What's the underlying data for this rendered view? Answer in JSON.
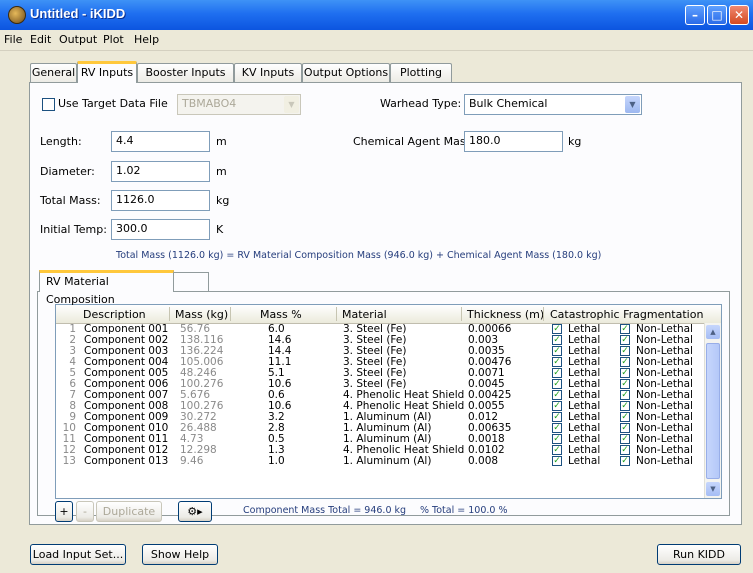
{
  "window": {
    "title": "Untitled - iKIDD",
    "controls": {
      "minimize": "–",
      "maximize": "□",
      "close": "✕"
    }
  },
  "menu": [
    "File",
    "Edit",
    "Output",
    "Plot",
    "Help"
  ],
  "tabs": [
    "General",
    "RV Inputs",
    "Booster Inputs",
    "KV Inputs",
    "Output Options",
    "Plotting"
  ],
  "active_tab": "RV Inputs",
  "form": {
    "use_target_label": "Use Target Data File",
    "target_file": "TBMABO4",
    "warhead_label": "Warhead Type:",
    "warhead_value": "Bulk Chemical",
    "length_label": "Length:",
    "length_value": "4.4",
    "length_unit": "m",
    "diameter_label": "Diameter:",
    "diameter_value": "1.02",
    "diameter_unit": "m",
    "total_mass_label": "Total Mass:",
    "total_mass_value": "1126.0",
    "total_mass_unit": "kg",
    "initial_temp_label": "Initial Temp:",
    "initial_temp_value": "300.0",
    "initial_temp_unit": "K",
    "agent_mass_label": "Chemical Agent Mass:",
    "agent_mass_value": "180.0",
    "agent_mass_unit": "kg",
    "mass_note": "Total Mass (1126.0 kg) = RV Material Composition Mass (946.0 kg) + Chemical Agent Mass (180.0 kg)"
  },
  "composition": {
    "tab_label": "RV Material Composition",
    "headers": [
      "Description",
      "Mass (kg)",
      "Mass %",
      "Material",
      "Thickness (m)",
      "Catastrophic Fragmentation"
    ],
    "lethal_label": "Lethal",
    "nonlethal_label": "Non-Lethal",
    "rows": [
      {
        "n": "1",
        "desc": "Component 001",
        "mass": "56.76",
        "pct": "6.0",
        "mat": "3. Steel (Fe)",
        "thick": "0.00066"
      },
      {
        "n": "2",
        "desc": "Component 002",
        "mass": "138.116",
        "pct": "14.6",
        "mat": "3. Steel (Fe)",
        "thick": "0.003"
      },
      {
        "n": "3",
        "desc": "Component 003",
        "mass": "136.224",
        "pct": "14.4",
        "mat": "3. Steel (Fe)",
        "thick": "0.0035"
      },
      {
        "n": "4",
        "desc": "Component 004",
        "mass": "105.006",
        "pct": "11.1",
        "mat": "3. Steel (Fe)",
        "thick": "0.00476"
      },
      {
        "n": "5",
        "desc": "Component 005",
        "mass": "48.246",
        "pct": "5.1",
        "mat": "3. Steel (Fe)",
        "thick": "0.0071"
      },
      {
        "n": "6",
        "desc": "Component 006",
        "mass": "100.276",
        "pct": "10.6",
        "mat": "3. Steel (Fe)",
        "thick": "0.0045"
      },
      {
        "n": "7",
        "desc": "Component 007",
        "mass": "5.676",
        "pct": "0.6",
        "mat": "4. Phenolic Heat Shield",
        "thick": "0.00425"
      },
      {
        "n": "8",
        "desc": "Component 008",
        "mass": "100.276",
        "pct": "10.6",
        "mat": "4. Phenolic Heat Shield",
        "thick": "0.0055"
      },
      {
        "n": "9",
        "desc": "Component 009",
        "mass": "30.272",
        "pct": "3.2",
        "mat": "1. Aluminum (Al)",
        "thick": "0.012"
      },
      {
        "n": "10",
        "desc": "Component 010",
        "mass": "26.488",
        "pct": "2.8",
        "mat": "1. Aluminum (Al)",
        "thick": "0.00635"
      },
      {
        "n": "11",
        "desc": "Component 011",
        "mass": "4.73",
        "pct": "0.5",
        "mat": "1. Aluminum (Al)",
        "thick": "0.0018"
      },
      {
        "n": "12",
        "desc": "Component 012",
        "mass": "12.298",
        "pct": "1.3",
        "mat": "4. Phenolic Heat Shield",
        "thick": "0.0102"
      },
      {
        "n": "13",
        "desc": "Component 013",
        "mass": "9.46",
        "pct": "1.0",
        "mat": "1. Aluminum (Al)",
        "thick": "0.008"
      }
    ],
    "add_label": "+",
    "remove_label": "-",
    "duplicate_label": "Duplicate",
    "component_total": "Component Mass Total = 946.0 kg",
    "percent_total": "% Total = 100.0 %"
  },
  "buttons": {
    "load": "Load Input Set...",
    "help": "Show Help",
    "run": "Run KIDD"
  },
  "colors": {
    "title_bar": "#1f6ff0",
    "active_tab_accent": "#ffc83c",
    "check_mark": "#21a121"
  }
}
